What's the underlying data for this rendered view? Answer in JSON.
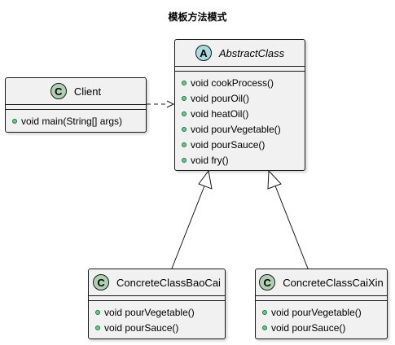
{
  "diagram": {
    "title": "模板方法模式",
    "classes": {
      "client": {
        "stereotype": "C",
        "name": "Client",
        "methods": [
          "void main(String[] args)"
        ]
      },
      "abstract_class": {
        "stereotype": "A",
        "name": "AbstractClass",
        "methods": [
          "void cookProcess()",
          "void pourOil()",
          "void heatOil()",
          "void pourVegetable()",
          "void pourSauce()",
          "void fry()"
        ]
      },
      "concrete_baocai": {
        "stereotype": "C",
        "name": "ConcreteClassBaoCai",
        "methods": [
          "void pourVegetable()",
          "void pourSauce()"
        ]
      },
      "concrete_caixin": {
        "stereotype": "C",
        "name": "ConcreteClassCaiXin",
        "methods": [
          "void pourVegetable()",
          "void pourSauce()"
        ]
      }
    },
    "relations": [
      {
        "from": "Client",
        "to": "AbstractClass",
        "type": "dependency"
      },
      {
        "from": "ConcreteClassBaoCai",
        "to": "AbstractClass",
        "type": "inheritance"
      },
      {
        "from": "ConcreteClassCaiXin",
        "to": "AbstractClass",
        "type": "inheritance"
      }
    ],
    "colors": {
      "class_fill": "#f1f1f1",
      "border": "#181818",
      "class_badge": "#add1b2",
      "abstract_badge": "#a9dcdf",
      "method_dot": "#84be84"
    }
  }
}
